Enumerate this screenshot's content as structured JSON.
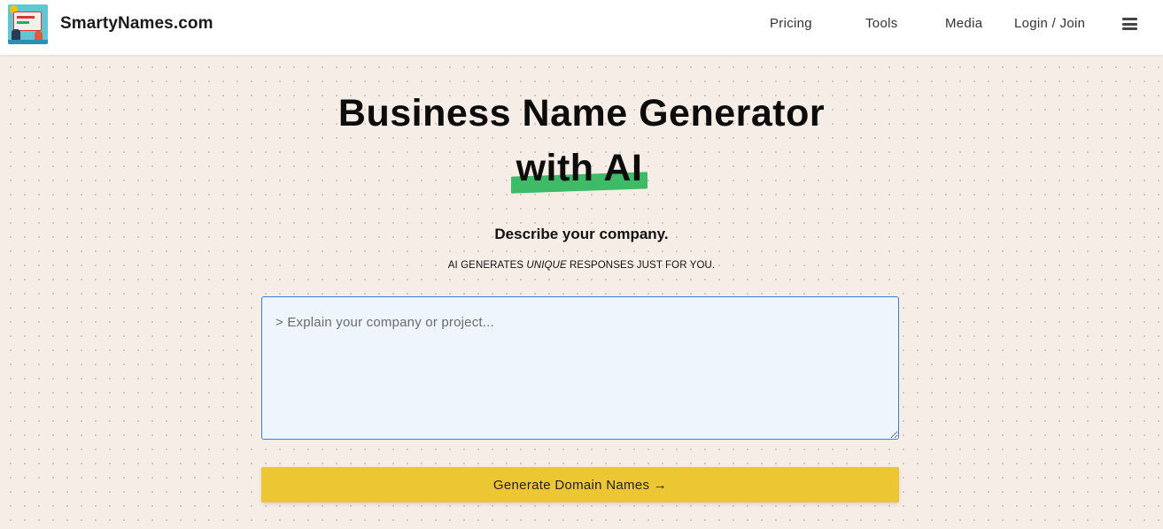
{
  "header": {
    "brand": "SmartyNames.com",
    "nav": {
      "pricing": "Pricing",
      "tools": "Tools",
      "media": "Media",
      "login": "Login / Join"
    },
    "menu_icon": "hamburger-menu-icon"
  },
  "hero": {
    "title_line1": "Business Name Generator",
    "title_line2": "with AI",
    "subtitle": "Describe your company.",
    "tagline_pre": "AI GENERATES ",
    "tagline_em": "UNIQUE",
    "tagline_post": " RESPONSES JUST FOR YOU."
  },
  "form": {
    "placeholder": "> Explain your company or project...",
    "value": "",
    "button_label": "Generate Domain Names →"
  },
  "colors": {
    "background": "#f6eee6",
    "highlight": "#3dbb67",
    "button": "#ecc733",
    "input_bg": "#eef5fd",
    "input_border": "#3a7fd5"
  }
}
